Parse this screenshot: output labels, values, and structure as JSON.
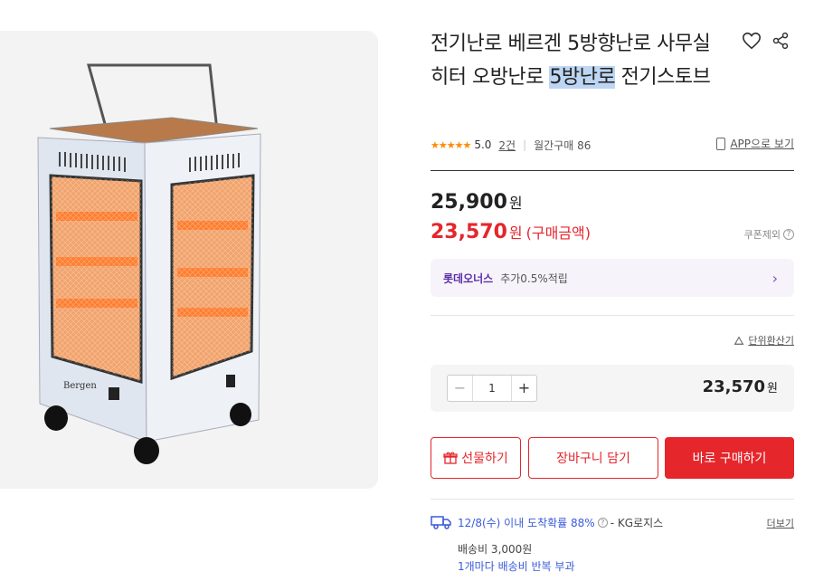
{
  "product": {
    "title_before": "전기난로 베르겐 5방향난로 사무실 히터 오방난로 ",
    "title_highlight": "5방난로",
    "title_after": " 전기스토브",
    "brand_mark": "Bergen",
    "rating_stars": "★★★★★",
    "rating_score": "5.0",
    "review_count": "2건",
    "monthly_sales": "월간구매 86",
    "app_link": "APP으로 보기"
  },
  "price": {
    "original": "25,900",
    "currency": "원",
    "sale": "23,570",
    "sale_label": "(구매금액)",
    "coupon_excluded": "쿠폰제외",
    "sale_color": "#e5262b"
  },
  "lotte": {
    "name": "롯데오너스",
    "desc": "추가0.5%적립",
    "color": "#5b2ea6"
  },
  "unit_calc": "단위환산기",
  "quantity": {
    "minus": "−",
    "value": "1",
    "plus": "+",
    "total": "23,570",
    "currency": "원"
  },
  "buttons": {
    "gift": "선물하기",
    "cart": "장바구니 담기",
    "buy": "바로 구매하기"
  },
  "shipping": {
    "arrival": "12/8(수) 이내 도착확률 88%",
    "help": "?",
    "carrier": "- KG로지스",
    "more": "더보기",
    "fee": "배송비 3,000원",
    "note": "1개마다 배송비 반복 부과"
  }
}
